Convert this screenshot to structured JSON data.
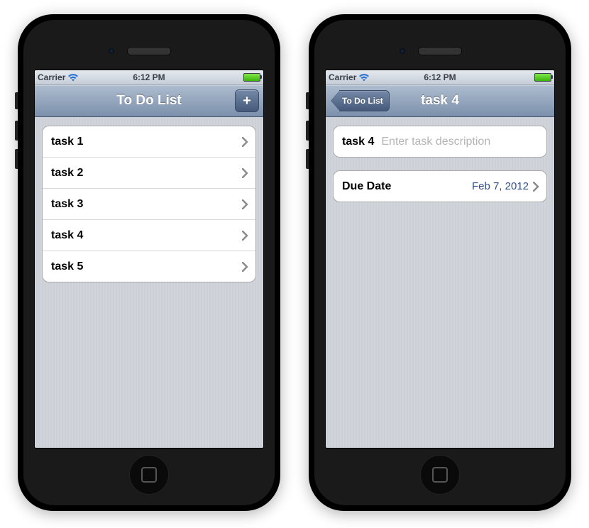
{
  "statusBar": {
    "carrier": "Carrier",
    "time": "6:12 PM"
  },
  "listScreen": {
    "title": "To Do List",
    "addGlyph": "+",
    "tasks": [
      {
        "label": "task 1"
      },
      {
        "label": "task 2"
      },
      {
        "label": "task 3"
      },
      {
        "label": "task 4"
      },
      {
        "label": "task 5"
      }
    ]
  },
  "detailScreen": {
    "backLabel": "To Do List",
    "title": "task 4",
    "taskName": "task 4",
    "descriptionPlaceholder": "Enter task description",
    "dueDateLabel": "Due Date",
    "dueDateValue": "Feb 7, 2012"
  }
}
